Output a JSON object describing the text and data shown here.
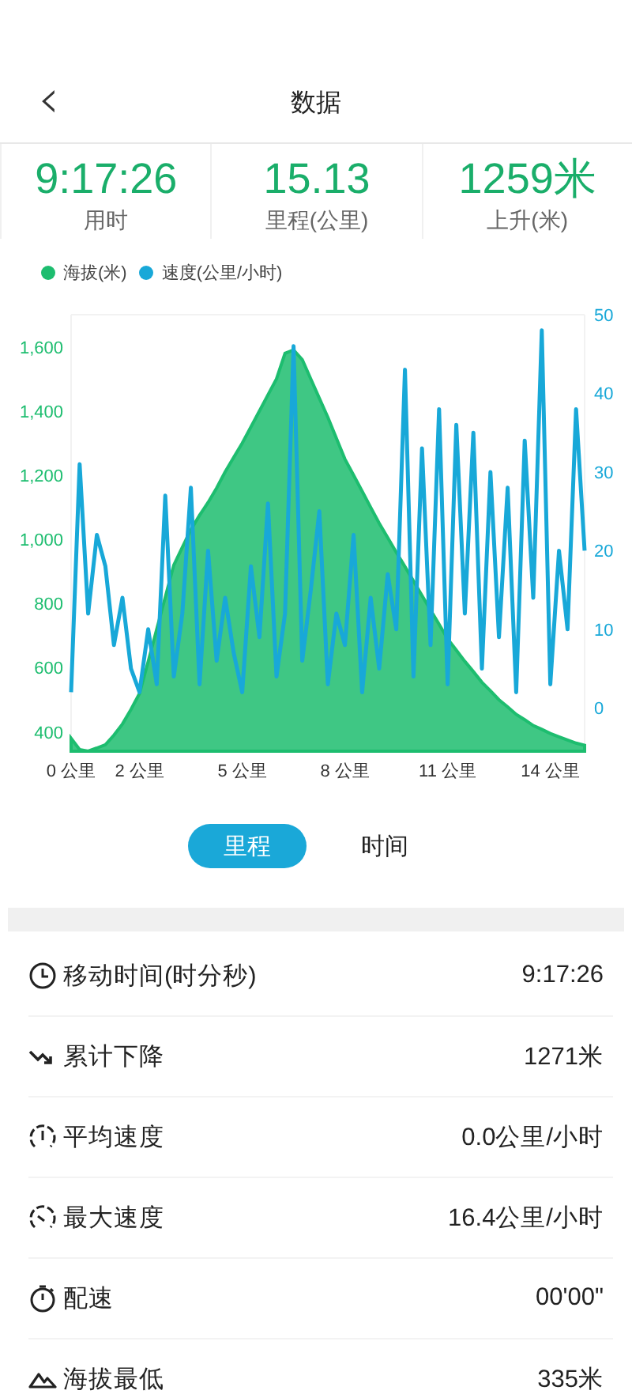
{
  "header": {
    "back_icon": "‹",
    "title": "数据"
  },
  "stats": [
    {
      "value": "9:17:26",
      "label": "用时"
    },
    {
      "value": "15.13",
      "label": "里程(公里)"
    },
    {
      "value": "1259米",
      "label": "上升(米)"
    }
  ],
  "chart": {
    "chart_data": {
      "type": "line",
      "x": [
        0,
        0.25,
        0.5,
        0.75,
        1,
        1.25,
        1.5,
        1.75,
        2,
        2.25,
        2.5,
        2.75,
        3,
        3.25,
        3.5,
        3.75,
        4,
        4.25,
        4.5,
        4.75,
        5,
        5.25,
        5.5,
        5.75,
        6,
        6.25,
        6.5,
        6.75,
        7,
        7.25,
        7.5,
        7.75,
        8,
        8.25,
        8.5,
        8.75,
        9,
        9.25,
        9.5,
        9.75,
        10,
        10.25,
        10.5,
        10.75,
        11,
        11.25,
        11.5,
        11.75,
        12,
        12.25,
        12.5,
        12.75,
        13,
        13.25,
        13.5,
        13.75,
        14,
        14.25,
        14.5,
        14.75,
        15
      ],
      "xlim": [
        0,
        15
      ],
      "ylim": [
        340,
        1700
      ],
      "y2lim": [
        -5.5,
        50
      ],
      "xticks": [
        {
          "value": 0,
          "label": "0 公里"
        },
        {
          "value": 2,
          "label": "2 公里"
        },
        {
          "value": 5,
          "label": "5 公里"
        },
        {
          "value": 8,
          "label": "8 公里"
        },
        {
          "value": 11,
          "label": "11 公里"
        },
        {
          "value": 14,
          "label": "14 公里"
        }
      ],
      "yticks": [
        {
          "value": 400,
          "label": "400"
        },
        {
          "value": 600,
          "label": "600"
        },
        {
          "value": 800,
          "label": "800"
        },
        {
          "value": 1000,
          "label": "1,000"
        },
        {
          "value": 1200,
          "label": "1,200"
        },
        {
          "value": 1400,
          "label": "1,400"
        },
        {
          "value": 1600,
          "label": "1,600"
        }
      ],
      "y2ticks": [
        0,
        10,
        20,
        30,
        40,
        50
      ],
      "series": [
        {
          "name": "海拔(米)",
          "type": "area",
          "axis": "y",
          "color": "#1dbd6f",
          "values": [
            380,
            345,
            340,
            350,
            360,
            390,
            425,
            470,
            520,
            620,
            720,
            820,
            920,
            975,
            1030,
            1075,
            1115,
            1160,
            1210,
            1255,
            1300,
            1350,
            1400,
            1450,
            1500,
            1580,
            1590,
            1560,
            1500,
            1440,
            1380,
            1315,
            1250,
            1200,
            1150,
            1100,
            1050,
            1005,
            960,
            915,
            870,
            825,
            780,
            735,
            690,
            655,
            620,
            588,
            555,
            528,
            500,
            478,
            455,
            438,
            420,
            408,
            395,
            385,
            375,
            365,
            358
          ]
        },
        {
          "name": "速度(公里/小时)",
          "type": "line",
          "axis": "y2",
          "color": "#18a8d8",
          "values": [
            2,
            31,
            12,
            22,
            18,
            8,
            14,
            5,
            2,
            10,
            3,
            27,
            4,
            12,
            28,
            3,
            20,
            6,
            14,
            7,
            2,
            18,
            9,
            26,
            4,
            12,
            46,
            6,
            15,
            25,
            3,
            12,
            8,
            22,
            2,
            14,
            5,
            17,
            10,
            43,
            4,
            33,
            8,
            38,
            3,
            36,
            12,
            35,
            5,
            30,
            9,
            28,
            2,
            34,
            14,
            48,
            3,
            20,
            10,
            38,
            20
          ]
        }
      ]
    }
  },
  "toggle": [
    {
      "label": "里程",
      "selected": true
    },
    {
      "label": "时间",
      "selected": false
    }
  ],
  "details": [
    {
      "label": "移动时间(时分秒)",
      "value": "9:17:26"
    },
    {
      "label": "累计下降",
      "value": "1271米"
    },
    {
      "label": "平均速度",
      "value": "0.0公里/小时"
    },
    {
      "label": "最大速度",
      "value": "16.4公里/小时"
    },
    {
      "label": "配速",
      "value": "00'00\""
    },
    {
      "label": "海拔最低",
      "value": "335米"
    }
  ]
}
